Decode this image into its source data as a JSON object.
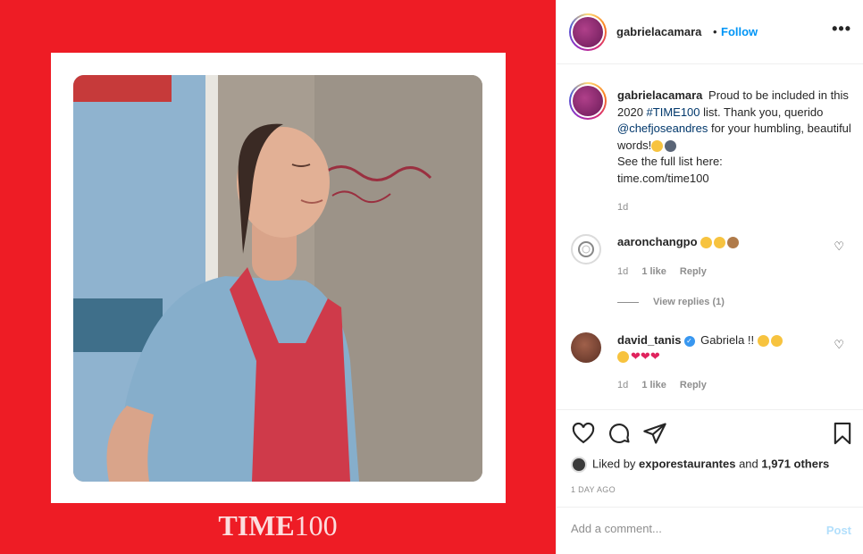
{
  "media": {
    "logo_word": "TIME",
    "logo_number": "100",
    "photo_alt": "woman in blue shirt and red apron"
  },
  "header": {
    "username": "gabrielacamara",
    "separator": "•",
    "follow_label": "Follow",
    "more_label": "•••"
  },
  "caption": {
    "username": "gabrielacamara",
    "text_1": "Proud to be included in this 2020 ",
    "hashtag": "#TIME100",
    "text_2": " list. Thank you, querido ",
    "mention": "@chefjoseandres",
    "text_3": " for your humbling, beautiful words!",
    "text_4": "See the full list here:",
    "url": "time.com/time100",
    "time": "1d"
  },
  "comments": [
    {
      "username": "aaronchangpo",
      "time": "1d",
      "likes": "1 like",
      "reply_label": "Reply",
      "view_replies": "View replies (1)"
    },
    {
      "username": "david_tanis",
      "text": "Gabriela !!",
      "time": "1d",
      "likes": "1 like",
      "reply_label": "Reply"
    }
  ],
  "actions": {
    "liked_prefix": "Liked by",
    "liked_user": "exporestaurantes",
    "liked_and": "and",
    "liked_count": "1,971 others",
    "ago": "1 DAY AGO"
  },
  "add_comment": {
    "placeholder": "Add a comment...",
    "post_label": "Post"
  },
  "colors": {
    "background_red": "#ee1c25",
    "link_blue": "#0095f6",
    "heart_red": "#e0245e"
  }
}
